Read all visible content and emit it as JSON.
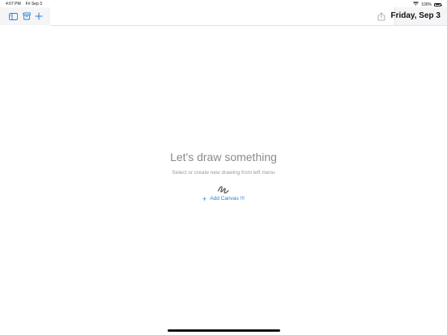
{
  "status_bar": {
    "time": "4:07 PM",
    "date": "Fri Sep 3",
    "battery": "100%"
  },
  "toolbar": {
    "sidebar_icon": "sidebar-icon",
    "archive_icon": "archive-box-icon",
    "add_icon": "plus-icon",
    "share_icon": "upload-icon",
    "accent_color": "#2a7bd4"
  },
  "date_panel": {
    "title": "Friday, Sep 3"
  },
  "empty_state": {
    "title": "Let's draw something",
    "subtitle": "Select or create new drawing from left menu",
    "icon": "scribble-icon",
    "add_label": "Add Canvas !!!",
    "add_icon": "plus-icon"
  }
}
